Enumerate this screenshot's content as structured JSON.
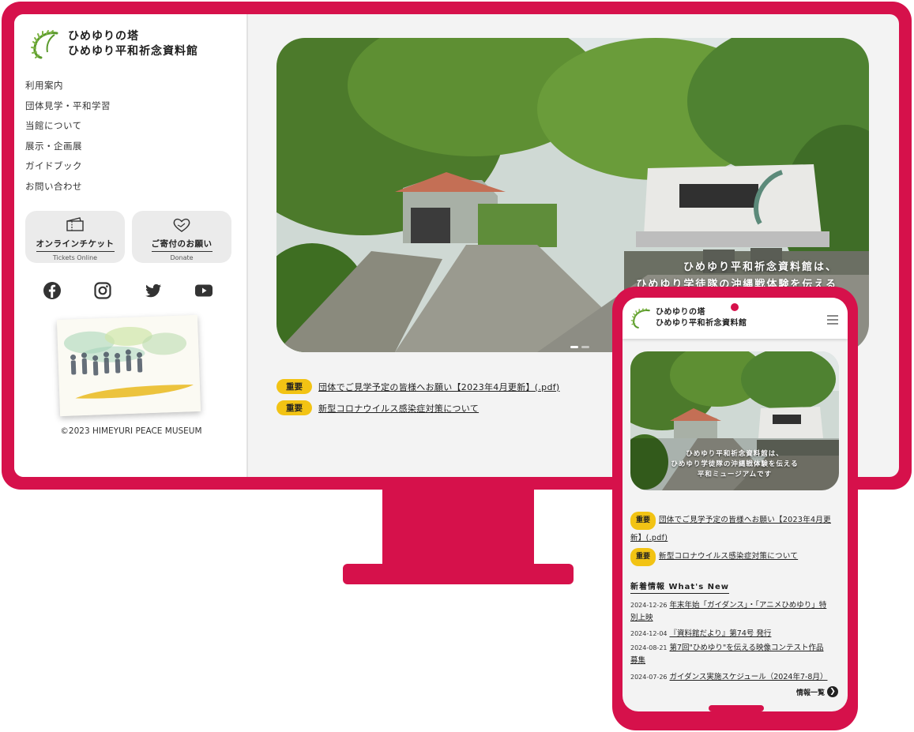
{
  "colors": {
    "brand": "#d6114b",
    "badge": "#f2c314",
    "screen_bg": "#f3f3f3"
  },
  "site": {
    "title_line1": "ひめゆりの塔",
    "title_line2": "ひめゆり平和祈念資料館",
    "logo_icon": "fern-leaf-icon"
  },
  "nav": [
    "利用案内",
    "団体見学・平和学習",
    "当館について",
    "展示・企画展",
    "ガイドブック",
    "お問い合わせ"
  ],
  "buttons": {
    "tickets": {
      "label": "オンラインチケット",
      "sub": "Tickets Online",
      "icon": "ticket-icon"
    },
    "donate": {
      "label": "ご寄付のお願い",
      "sub": "Donate",
      "icon": "heart-hands-icon"
    }
  },
  "social": [
    "facebook-icon",
    "instagram-icon",
    "twitter-icon",
    "youtube-icon"
  ],
  "copyright": "©2023 HIMEYURI PEACE MUSEUM",
  "hero": {
    "caption_line1": "ひめゆり平和祈念資料館は、",
    "caption_line2": "ひめゆり学徒隊の沖縄戦体験を伝える"
  },
  "notices": [
    {
      "badge": "重要",
      "text": "団体でご見学予定の皆様へお願い【2023年4月更新】(.pdf)"
    },
    {
      "badge": "重要",
      "text": "新型コロナウイルス感染症対策について"
    }
  ],
  "phone": {
    "hero_caption_line1": "ひめゆり平和祈念資料館は、",
    "hero_caption_line2": "ひめゆり学徒隊の沖縄戦体験を伝える",
    "hero_caption_line3": "平和ミュージアムです",
    "notice1_text_a": "団体でご見学予定の皆様へお願い【2023年4月更",
    "notice1_text_b": "新】(.pdf)",
    "news_title": "新着情報 What's New",
    "news": [
      {
        "date": "2024-12-26",
        "text_a": "年末年始「ガイダンス」・「アニメひめゆり」特",
        "text_b": "別上映"
      },
      {
        "date": "2024-12-04",
        "text_a": "『資料館だより』第74号 発行",
        "text_b": ""
      },
      {
        "date": "2024-08-21",
        "text_a": "第7回\"ひめゆり\"を伝える映像コンテスト作品",
        "text_b": "募集"
      },
      {
        "date": "2024-07-26",
        "text_a": "ガイダンス実施スケジュール（2024年7-8月）",
        "text_b": ""
      }
    ],
    "more_label": "情報一覧"
  }
}
